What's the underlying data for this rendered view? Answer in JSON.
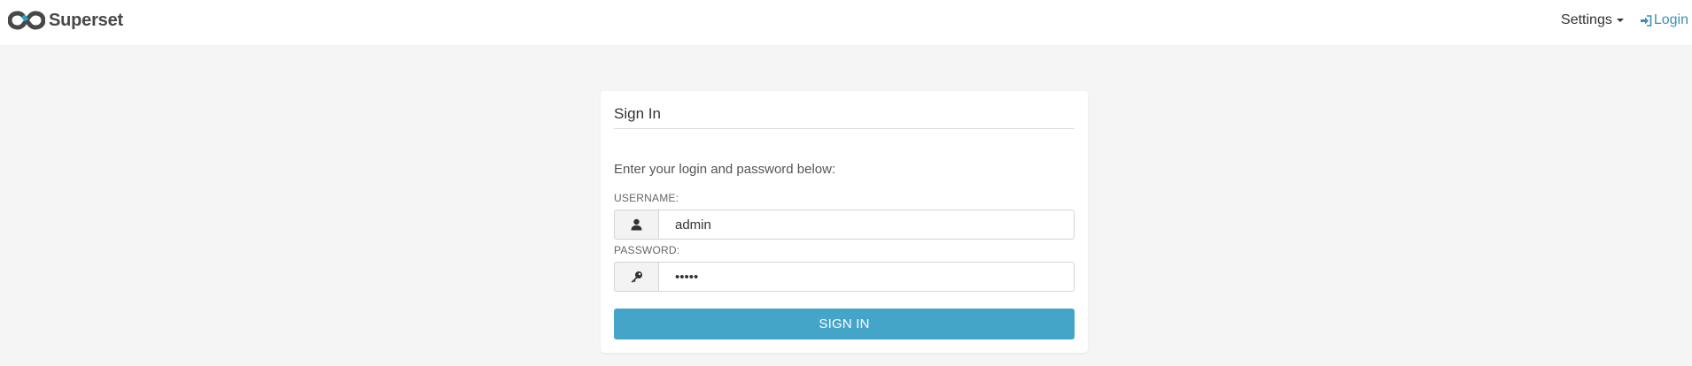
{
  "navbar": {
    "brand_name": "Superset",
    "settings_label": "Settings",
    "login_label": "Login"
  },
  "login": {
    "title": "Sign In",
    "intro": "Enter your login and password below:",
    "username_label": "USERNAME:",
    "username_value": "admin",
    "password_label": "PASSWORD:",
    "password_value": "admin",
    "submit_label": "SIGN IN"
  },
  "icons": {
    "brand": "superset-logo-icon",
    "settings_caret": "caret-down-icon",
    "login": "sign-in-icon",
    "username": "user-icon",
    "password": "key-icon"
  },
  "colors": {
    "accent": "#45a5c8",
    "link": "#3e8eb5",
    "page_background": "#f5f5f5"
  }
}
